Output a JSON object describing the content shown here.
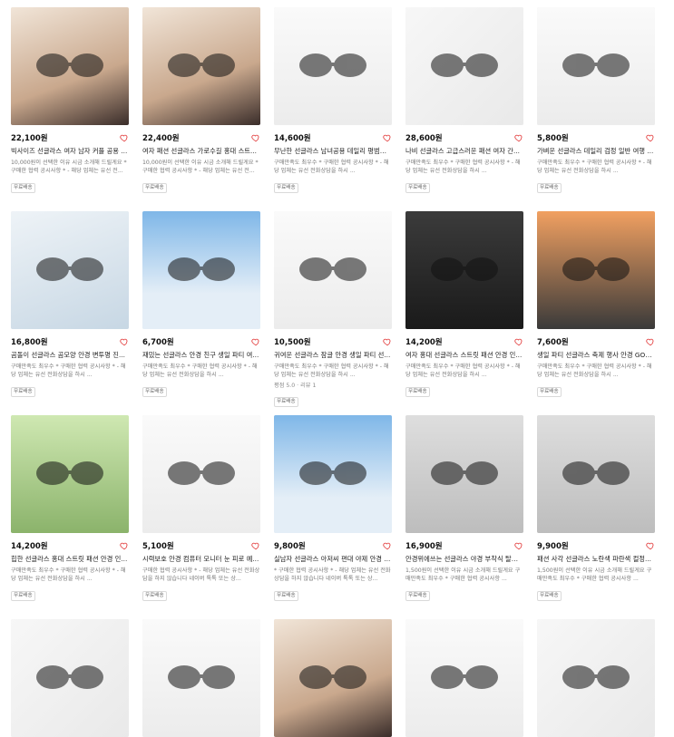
{
  "products": [
    {
      "price": "22,100원",
      "title": "빅사이즈 선글라스 여자 남자 커플 공용 ...",
      "desc": "10,000원이 선택한 이유 시금 소개해 드릴게요 * 구매한 협력 공시사항 * - 해당 업체는 유선 전...",
      "meta": "",
      "badge": "무료배송",
      "tone": "t-warm"
    },
    {
      "price": "22,400원",
      "title": "여자 패션 선글라스 가로수길 홍대 스트...",
      "desc": "10,000원이 선택한 이유 시금 소개해 드릴게요 * 구매한 협력 공시사항 * - 해당 업체는 유선 전...",
      "meta": "",
      "badge": "무료배송",
      "tone": "t-warm"
    },
    {
      "price": "14,600원",
      "title": "무난한 선글라스 남녀공용 데일리 평범한...",
      "desc": "구매만족도 최우수 * 구매한 협력 공시사항 * - 해당 업체는 유선 전화상담을 하시 ...",
      "meta": "",
      "badge": "무료배송",
      "tone": "t-white"
    },
    {
      "price": "28,600원",
      "title": "나비 선글라스 고급스러운 패션 여자 간...",
      "desc": "구매만족도 최우수 * 구매한 협력 공시사항 * - 해당 업체는 유선 전화상담을 하시 ...",
      "meta": "",
      "badge": "무료배송",
      "tone": "t-neon"
    },
    {
      "price": "5,800원",
      "title": "가벼운 선글라스 데일리 검정 일반 여행 ...",
      "desc": "구매만족도 최우수 * 구매한 협력 공시사항 * - 해당 업체는 유선 전화상담을 하시 ...",
      "meta": "",
      "badge": "무료배송",
      "tone": "t-white"
    },
    {
      "price": "16,800원",
      "title": "곰돌이 선글라스 곰모양 안경 변투명 진...",
      "desc": "구매만족도 최우수 * 구매한 협력 공시사항 * - 해당 업체는 유선 전화상담을 하시 ...",
      "meta": "",
      "badge": "무료배송",
      "tone": "t-cool"
    },
    {
      "price": "6,700원",
      "title": "재밌는 선글라스 안경 친구 생일 파티 여...",
      "desc": "구매만족도 최우수 * 구매한 협력 공시사항 * - 해당 업체는 유선 전화상담을 하시 ...",
      "meta": "",
      "badge": "무료배송",
      "tone": "t-sky"
    },
    {
      "price": "10,500원",
      "title": "귀여운 선글라스 잠글 안경 생일 파티 선...",
      "desc": "구매만족도 최우수 * 구매한 협력 공시사항 * - 해당 업체는 유선 전화상담을 하시 ...",
      "meta": "평점 5.0 · 리뷰 1",
      "badge": "무료배송",
      "tone": "t-white"
    },
    {
      "price": "14,200원",
      "title": "여자 홍대 선글라스 스트릿 패션 안경 인...",
      "desc": "구매만족도 최우수 * 구매한 협력 공시사항 * - 해당 업체는 유선 전화상담을 하시 ...",
      "meta": "",
      "badge": "무료배송",
      "tone": "t-dark"
    },
    {
      "price": "7,600원",
      "title": "생일 파티 선글라스 축제 행사 안경 GOO...",
      "desc": "구매만족도 최우수 * 구매한 협력 공시사항 * - 해당 업체는 유선 전화상담을 하시 ...",
      "meta": "",
      "badge": "무료배송",
      "tone": "t-orange"
    },
    {
      "price": "14,200원",
      "title": "힙한 선글라스 홍대 스트릿 패션 안경 인...",
      "desc": "구매만족도 최우수 * 구매한 협력 공시사항 * - 해당 업체는 유선 전화상담을 하시 ...",
      "meta": "",
      "badge": "무료배송",
      "tone": "t-green"
    },
    {
      "price": "5,100원",
      "title": "시력보호 안경 컴퓨터 모니터 눈 피로 예...",
      "desc": "구매한 협력 공시사항 * - 해당 업체는 유선 전화상담을 하지 않습니다 네이버 톡톡 또는 상...",
      "meta": "",
      "badge": "무료배송",
      "tone": "t-white"
    },
    {
      "price": "9,800원",
      "title": "실남자 선글라스 아저씨 편대 야제 안경 ...",
      "desc": "* 구매한 협력 공시사항 * - 해당 업체는 유선 전화상담을 하지 않습니다 네이버 톡톡 또는 상...",
      "meta": "",
      "badge": "무료배송",
      "tone": "t-sky"
    },
    {
      "price": "16,900원",
      "title": "안경위에쓰는 선글라스 야경 부착식 탈부...",
      "desc": "1,500원이 선택한 이유 시금 소개해 드릴게요 구매만족도 최우수 * 구매한 협력 공시사항 ...",
      "meta": "",
      "badge": "무료배송",
      "tone": "t-grey"
    },
    {
      "price": "9,900원",
      "title": "패션 사각 선글라스 노란색 파란색 컬정...",
      "desc": "1,500원이 선택한 이유 시금 소개해 드릴게요 구매만족도 최우수 * 구매한 협력 공시사항 ...",
      "meta": "",
      "badge": "무료배송",
      "tone": "t-grey"
    },
    {
      "price": "",
      "title": "",
      "desc": "",
      "meta": "",
      "badge": "",
      "tone": "t-neon"
    },
    {
      "price": "",
      "title": "",
      "desc": "",
      "meta": "",
      "badge": "",
      "tone": "t-white"
    },
    {
      "price": "",
      "title": "",
      "desc": "",
      "meta": "",
      "badge": "",
      "tone": "t-warm"
    },
    {
      "price": "",
      "title": "",
      "desc": "",
      "meta": "",
      "badge": "",
      "tone": "t-white"
    },
    {
      "price": "",
      "title": "",
      "desc": "",
      "meta": "",
      "badge": "",
      "tone": "t-neon"
    }
  ],
  "colors": {
    "heart": "#e23a3a",
    "accent": "#d8a300"
  }
}
